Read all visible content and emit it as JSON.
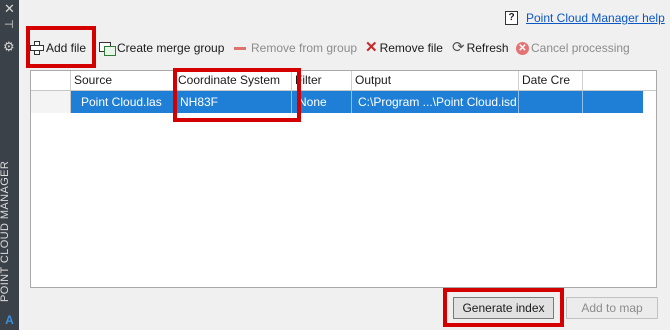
{
  "palette": {
    "title": "POINT CLOUD MANAGER",
    "close_icon": "close-icon",
    "pin_icon": "pin-icon",
    "settings_icon": "gear-icon",
    "logo_icon": "autocad-logo-icon"
  },
  "help": {
    "icon": "help-question-icon",
    "label": "Point Cloud Manager help"
  },
  "toolbar": {
    "add_file": "Add file",
    "create_merge_group": "Create merge group",
    "remove_from_group": "Remove from group",
    "remove_file": "Remove file",
    "refresh": "Refresh",
    "cancel_processing": "Cancel processing"
  },
  "table": {
    "columns": [
      "Source",
      "Coordinate System",
      "Filter",
      "Output",
      "Date Cre"
    ],
    "rows": [
      {
        "source": "Point Cloud.las",
        "coordinate_system": "NH83F",
        "filter": "None",
        "output": "C:\\Program ...\\Point Cloud.isd",
        "date_created": "",
        "selected": true
      }
    ]
  },
  "buttons": {
    "generate_index": "Generate index",
    "add_to_map": "Add to map"
  },
  "colors": {
    "selection": "#1f7fd6",
    "highlight": "#d40000",
    "link": "#0b57c4",
    "strip": "#3b4148"
  }
}
